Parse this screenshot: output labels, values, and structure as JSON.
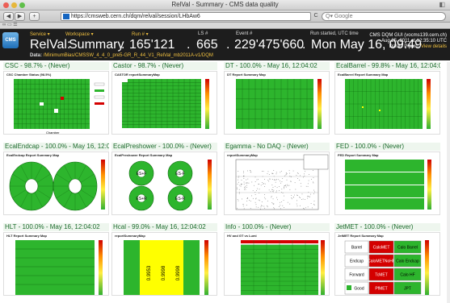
{
  "window": {
    "title": "RelVal - Summary - CMS data quality"
  },
  "toolbar": {
    "back": "◀",
    "forward": "▶",
    "add": "+",
    "url": "https://cmsweb.cern.ch/dqm/relval/session/LHbAw6",
    "reload": "C",
    "search_placeholder": "Google"
  },
  "header": {
    "logo": "CMS",
    "service_label": "Service ▾",
    "service": "RelVal:",
    "workspace_label": "Workspace ▾",
    "workspace": "Summary",
    "run_label": "Run # ▾",
    "run": "165'121",
    "ls_label": "LS #",
    "ls": "665",
    "event_label": "Event #",
    "event": "229'475'660",
    "started_label": "Run started, UTC time",
    "started": "Mon May 16, 09:49",
    "data_label": "Data:",
    "data_value": "/MinimumBias/CMSSW_4_4_0_pre5-GR_R_44_V1_RelVal_mb2011A-v1/DQM",
    "gui_line1": "CMS DQM GUI (vocms139.cern.ch)",
    "gui_line2": "Aug 25, 2011 at 12:35:10 UTC",
    "user": "Danilo Piparo,",
    "view_details": "View details"
  },
  "panels": [
    {
      "title": "CSC - 98.7% - (Never)",
      "subtitle": "CSC Chamber Status (98.5%)"
    },
    {
      "title": "Castor - 98.7% - (Never)",
      "subtitle": "CASTOR reportSummaryMap"
    },
    {
      "title": "DT - 100.0% - May 16, 12:04:02",
      "subtitle": "DT Report Summary Map"
    },
    {
      "title": "EcalBarrel - 99.8% - May 16, 12:04:02",
      "subtitle": "EcalBarrel Report Summary Map"
    },
    {
      "title": "EcalEndcap - 100.0% - May 16, 12:04:02",
      "subtitle": "EcalEndcap Report Summary Map"
    },
    {
      "title": "EcalPreshower - 100.0% - (Never)",
      "subtitle": "EcalPreshower Report Summary Map"
    },
    {
      "title": "Egamma - No DAQ - (Never)",
      "subtitle": "reportSummaryMap"
    },
    {
      "title": "FED - 100.0% - (Never)",
      "subtitle": "FED Report Summary Map"
    },
    {
      "title": "HLT - 100.0% - May 16, 12:04:02",
      "subtitle": "HLT Report Summary Map"
    },
    {
      "title": "Hcal - 99.0% - May 16, 12:04:02",
      "subtitle": "reportSummaryMap"
    },
    {
      "title": "Info - 100.0% - (Never)",
      "subtitle": "HV and GT vs Lumi"
    },
    {
      "title": "JetMET - 100.0% - (Never)",
      "subtitle": "JetMET Report Summary Map"
    }
  ],
  "es_labels": [
    "ES+F",
    "ES-F",
    "ES+R",
    "ES-R"
  ],
  "hcal_values": [
    "0.9953",
    "0.9998",
    "0.9998"
  ],
  "jetmet": {
    "rows": [
      [
        "Barrel",
        "CaloMET",
        "Calo Barrel"
      ],
      [
        "Endcap",
        "CaloMETNoHF",
        "Calo Endcap"
      ],
      [
        "Forward",
        "TcMET",
        "Calo HF"
      ],
      [
        "Good",
        "PfMET",
        "JPT"
      ]
    ]
  },
  "colors": {
    "good": "#2db52d",
    "bad": "#d40000",
    "warn": "#ffff00",
    "header_bg": "#1d1d1d",
    "accent": "#f0c040"
  }
}
